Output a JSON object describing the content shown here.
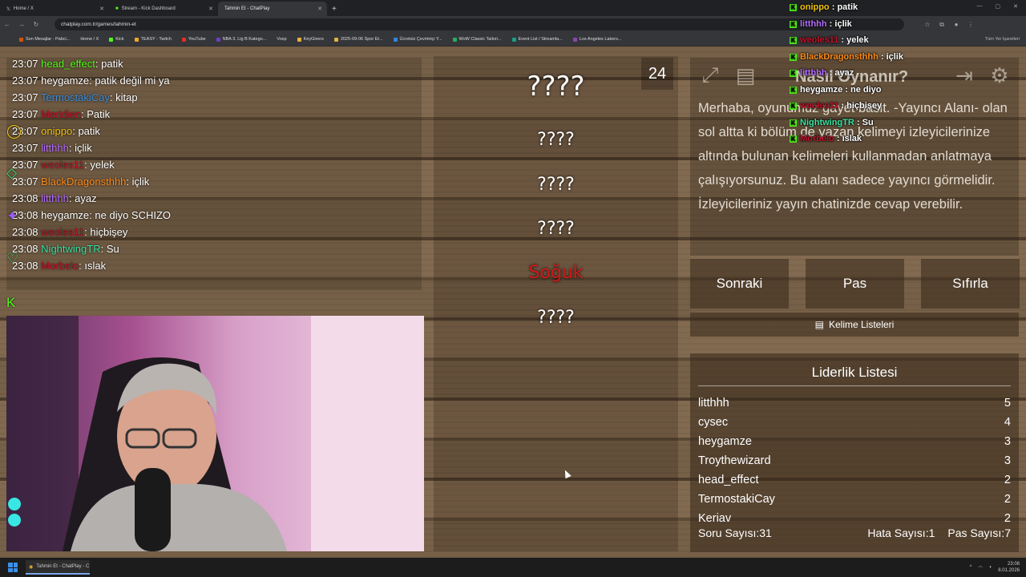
{
  "browser": {
    "tabs": [
      {
        "label": "Home / X",
        "active": false
      },
      {
        "label": "Stream - Kick Dashboard",
        "active": false
      },
      {
        "label": "Tahmin Et - ChatPlay",
        "active": true
      }
    ],
    "url": "chatplay.com.tr/games/tahmin-et",
    "bookmarks": [
      "Son Mesajlar - Pabci...",
      "Home / X",
      "Kick",
      "TEASY - Twitch",
      "YouTube",
      "NBA 3. Lig B Katego...",
      "Voxp",
      "KeyGivers",
      "2025-09-06 Spor Et...",
      "Ücretsiz Çevrimiçi Y...",
      "WoW Classic Tailori...",
      "Event List / Streamla...",
      "Los Angeles Lakers..."
    ],
    "all_bookmarks": "Tüm Yer İşaretleri",
    "colors": {
      "tab_bar": "#202124",
      "toolbar": "#35363a"
    }
  },
  "chat": {
    "lines": [
      {
        "time": "23:07",
        "user": "head_effect",
        "msg": "patik",
        "color": "#53fc18"
      },
      {
        "time": "23:07",
        "user": "heygamze",
        "msg": "patik değil mi ya",
        "color": "#ffffff"
      },
      {
        "time": "23:07",
        "user": "TermostakiCay",
        "msg": "kitap",
        "color": "#3f8fdb"
      },
      {
        "time": "23:07",
        "user": "Meridien",
        "msg": "Patik",
        "color": "#c0142a"
      },
      {
        "time": "23:07",
        "user": "onippo",
        "msg": "patik",
        "color": "#f1c40f"
      },
      {
        "time": "23:07",
        "user": "litthhh",
        "msg": "içlik",
        "color": "#b46cff"
      },
      {
        "time": "23:07",
        "user": "weoles11",
        "msg": "yelek",
        "color": "#c0142a"
      },
      {
        "time": "23:07",
        "user": "BlackDragonsthhh",
        "msg": "içlik",
        "color": "#ff8c1a"
      },
      {
        "time": "23:08",
        "user": "litthhh",
        "msg": "ayaz",
        "color": "#b46cff"
      },
      {
        "time": "23:08",
        "user": "heygamze",
        "msg": "ne diyo SCHIZO",
        "color": "#ffffff"
      },
      {
        "time": "23:08",
        "user": "weoles11",
        "msg": "hiçbişey",
        "color": "#c0142a"
      },
      {
        "time": "23:08",
        "user": "NightwingTR",
        "msg": "Su",
        "color": "#3ce2a0"
      },
      {
        "time": "23:08",
        "user": "Morbelo",
        "msg": "ıslak",
        "color": "#c0142a"
      }
    ]
  },
  "sidebar_icons": [
    {
      "name": "circle-badge-icon",
      "glyph": "◯",
      "color": "#f1c40f"
    },
    {
      "name": "diamond-badge-icon",
      "glyph": "◇",
      "color": "#3ce27a"
    },
    {
      "name": "star-badge-icon",
      "glyph": "✦",
      "color": "#9b59f6"
    },
    {
      "name": "heart-badge-icon",
      "glyph": "♡",
      "color": "#3ce27a"
    },
    {
      "name": "kick-badge-icon",
      "glyph": "K",
      "color": "#53fc18"
    },
    {
      "name": "kick-round-icon",
      "glyph": "K",
      "color": "#53fc18"
    }
  ],
  "game": {
    "question_count": "24",
    "words": [
      {
        "text": "????",
        "style": "main"
      },
      {
        "text": "????",
        "style": "normal"
      },
      {
        "text": "????",
        "style": "normal"
      },
      {
        "text": "????",
        "style": "normal"
      },
      {
        "text": "Soğuk",
        "style": "forbidden"
      },
      {
        "text": "????",
        "style": "normal"
      }
    ],
    "forbidden_color": "#d01a1a"
  },
  "howto": {
    "title": "Nasıl Oynanır?",
    "text": "Merhaba, oyunumuz gayet basit. -Yayıncı Alanı- olan sol altta ki bölüm de yazan kelimeyi izleyicilerinize altında bulunan kelimeleri kullanmadan anlatmaya çalışıyorsunuz. Bu alanı sadece yayıncı görmelidir. İzleyicileriniz yayın chatinizde cevap verebilir."
  },
  "controls": {
    "next": "Sonraki",
    "pass": "Pas",
    "reset": "Sıfırla",
    "word_lists": "Kelime Listeleri"
  },
  "leaderboard": {
    "title": "Liderlik Listesi",
    "rows": [
      {
        "name": "litthhh",
        "score": "5"
      },
      {
        "name": "cysec",
        "score": "4"
      },
      {
        "name": "heygamze",
        "score": "3"
      },
      {
        "name": "Troythewizard",
        "score": "3"
      },
      {
        "name": "head_effect",
        "score": "2"
      },
      {
        "name": "TermostakiCay",
        "score": "2"
      },
      {
        "name": "Keriav",
        "score": "2"
      }
    ],
    "question_label": "Soru Sayısı:",
    "question_value": "31",
    "error_label": "Hata Sayısı:",
    "error_value": "1",
    "pass_label": "Pas Sayısı:",
    "pass_value": "7"
  },
  "overlay_chat": [
    {
      "user": "onippo",
      "msg": "patik",
      "color": "#f1c40f"
    },
    {
      "user": "litthhh",
      "msg": "içlik",
      "color": "#b46cff"
    },
    {
      "user": "weoles11",
      "msg": "yelek",
      "color": "#c0142a"
    },
    {
      "user": "BlackDragonsthhh",
      "msg": "içlik",
      "color": "#ff8c1a"
    },
    {
      "user": "litthhh",
      "msg": "ayaz",
      "color": "#b46cff"
    },
    {
      "user": "heygamze",
      "msg": "ne diyo",
      "color": "#ffffff"
    },
    {
      "user": "weoles11",
      "msg": "hiçbişey",
      "color": "#c0142a"
    },
    {
      "user": "NightwingTR",
      "msg": "Su",
      "color": "#3ce2a0"
    },
    {
      "user": "Morbelo",
      "msg": "ıslak",
      "color": "#c0142a"
    }
  ],
  "taskbar": {
    "app_label": "Tahmin Et - ChatPlay - C",
    "time": "23:08",
    "date": "8.01.2026"
  }
}
